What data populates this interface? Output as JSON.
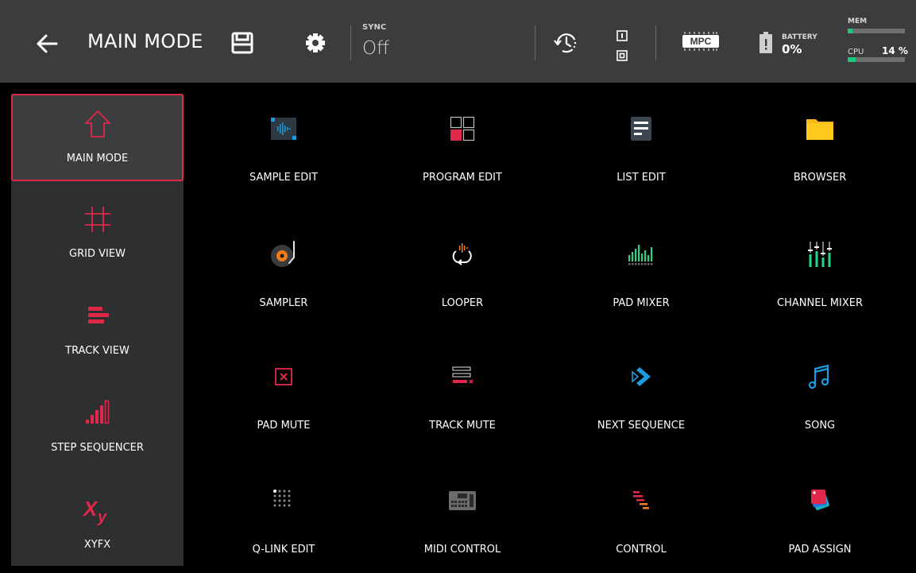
{
  "header": {
    "title": "MAIN MODE",
    "sync_label": "SYNC",
    "sync_value": "Off",
    "io_top": "I",
    "io_bottom": "O",
    "mpc_logo": "MPC",
    "battery_label": "BATTERY",
    "battery_value": "0%",
    "mem_label": "MEM",
    "mem_fraction": 0.08,
    "cpu_label": "CPU",
    "cpu_value": "14 %",
    "cpu_fraction": 0.14
  },
  "sidebar": {
    "items": [
      {
        "label": "MAIN MODE",
        "icon": "house-outline-icon",
        "active": true
      },
      {
        "label": "GRID VIEW",
        "icon": "grid-hash-icon"
      },
      {
        "label": "TRACK VIEW",
        "icon": "track-bars-icon"
      },
      {
        "label": "STEP SEQUENCER",
        "icon": "step-bars-icon"
      },
      {
        "label": "XYFX",
        "icon": "xy-icon"
      }
    ]
  },
  "modes": [
    {
      "label": "SAMPLE EDIT",
      "icon": "waveform-icon"
    },
    {
      "label": "PROGRAM EDIT",
      "icon": "program-grid-icon"
    },
    {
      "label": "LIST EDIT",
      "icon": "list-doc-icon"
    },
    {
      "label": "BROWSER",
      "icon": "folder-icon"
    },
    {
      "label": "SAMPLER",
      "icon": "turntable-icon"
    },
    {
      "label": "LOOPER",
      "icon": "loop-icon"
    },
    {
      "label": "PAD MIXER",
      "icon": "pad-meters-icon"
    },
    {
      "label": "CHANNEL MIXER",
      "icon": "faders-icon"
    },
    {
      "label": "PAD MUTE",
      "icon": "pad-mute-icon"
    },
    {
      "label": "TRACK MUTE",
      "icon": "track-mute-icon"
    },
    {
      "label": "NEXT SEQUENCE",
      "icon": "next-sequence-icon"
    },
    {
      "label": "SONG",
      "icon": "music-note-icon"
    },
    {
      "label": "Q-LINK EDIT",
      "icon": "dot-matrix-icon"
    },
    {
      "label": "MIDI CONTROL",
      "icon": "midi-controller-icon"
    },
    {
      "label": "CONTROL",
      "icon": "control-bars-icon"
    },
    {
      "label": "PAD ASSIGN",
      "icon": "pad-assign-icon"
    }
  ],
  "colors": {
    "accent": "#e0284a",
    "header_bg": "#3b3c3e",
    "sidebar_bg": "#2e2f31",
    "meter_green": "#1fc77a"
  }
}
